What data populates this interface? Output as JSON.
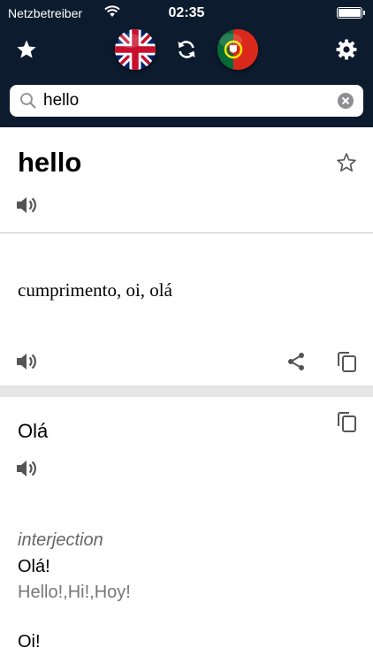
{
  "status_bar": {
    "carrier": "Netzbetreiber",
    "time": "02:35"
  },
  "toolbar": {
    "source_flag": "uk-flag",
    "target_flag": "portugal-flag",
    "accent_bg": "#0d1b2e"
  },
  "search": {
    "value": "hello"
  },
  "headword": {
    "text": "hello"
  },
  "translation": {
    "text": "cumprimento, oi, olá"
  },
  "entry": {
    "title": "Olá",
    "part_of_speech": "interjection",
    "examples": [
      {
        "text": "Olá!",
        "translation": "Hello!,Hi!,Hoy!"
      },
      {
        "text": "Oi!"
      }
    ]
  },
  "icons": [
    "star-icon",
    "swap-icon",
    "settings-icon",
    "search-icon",
    "clear-icon",
    "star-outline-icon",
    "speaker-icon",
    "share-icon",
    "copy-icon"
  ]
}
